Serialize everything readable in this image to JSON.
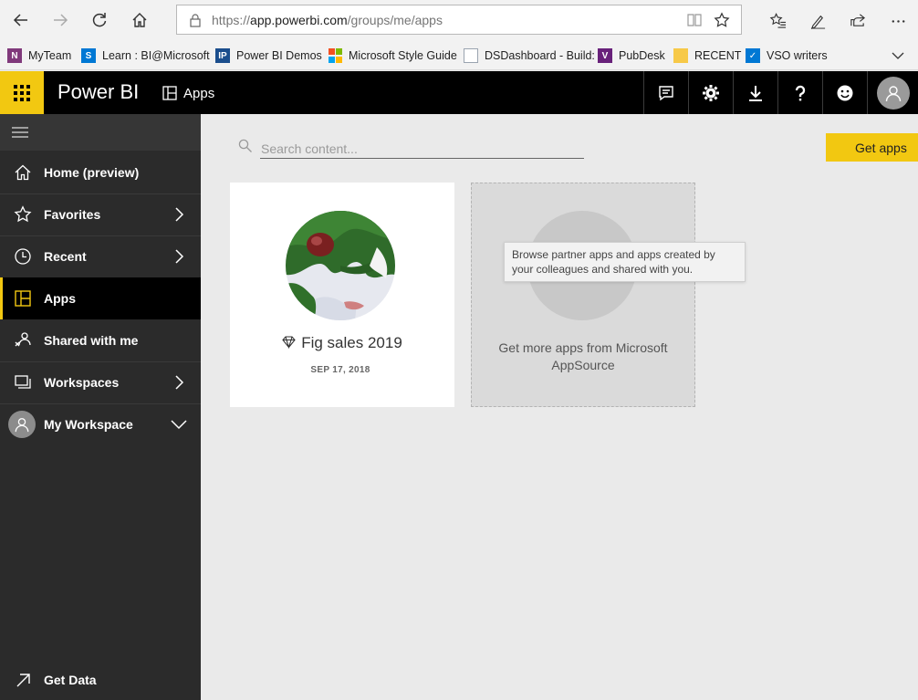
{
  "browser": {
    "url_prefix": "https://",
    "url_host": "app.powerbi.com",
    "url_path": "/groups/me/apps"
  },
  "favorites": [
    {
      "label": "MyTeam",
      "icon": "onenote-icon",
      "color": "#80397b"
    },
    {
      "label": "Learn : BI@Microsoft",
      "icon": "sharepoint-icon",
      "color": "#0078d4"
    },
    {
      "label": "Power BI Demos",
      "icon": "ip-icon",
      "color": "#1b4e8d"
    },
    {
      "label": "Microsoft Style Guide",
      "icon": "microsoft-logo-icon",
      "color": "#f25022"
    },
    {
      "label": "DSDashboard - Build:",
      "icon": "page-icon",
      "color": "#9aa4b0"
    },
    {
      "label": "PubDesk",
      "icon": "visual-studio-icon",
      "color": "#68217a"
    },
    {
      "label": "RECENT",
      "icon": "folder-icon",
      "color": "#f7c948"
    },
    {
      "label": "VSO writers",
      "icon": "azure-devops-icon",
      "color": "#0078d4"
    }
  ],
  "header": {
    "brand": "Power BI",
    "breadcrumb": "Apps",
    "brand_color": "#f2c811"
  },
  "sidebar": {
    "items": [
      {
        "label": "Home (preview)"
      },
      {
        "label": "Favorites"
      },
      {
        "label": "Recent"
      },
      {
        "label": "Apps"
      },
      {
        "label": "Shared with me"
      },
      {
        "label": "Workspaces"
      },
      {
        "label": "My Workspace"
      }
    ],
    "get_data": "Get Data"
  },
  "main": {
    "search_placeholder": "Search content...",
    "get_apps_label": "Get apps",
    "app_card": {
      "title": "Fig sales 2019",
      "date": "SEP 17, 2018"
    },
    "appsource_card": {
      "text": "Get more apps from Microsoft AppSource",
      "tooltip": "Browse partner apps and apps created by your colleagues and shared with you."
    }
  }
}
